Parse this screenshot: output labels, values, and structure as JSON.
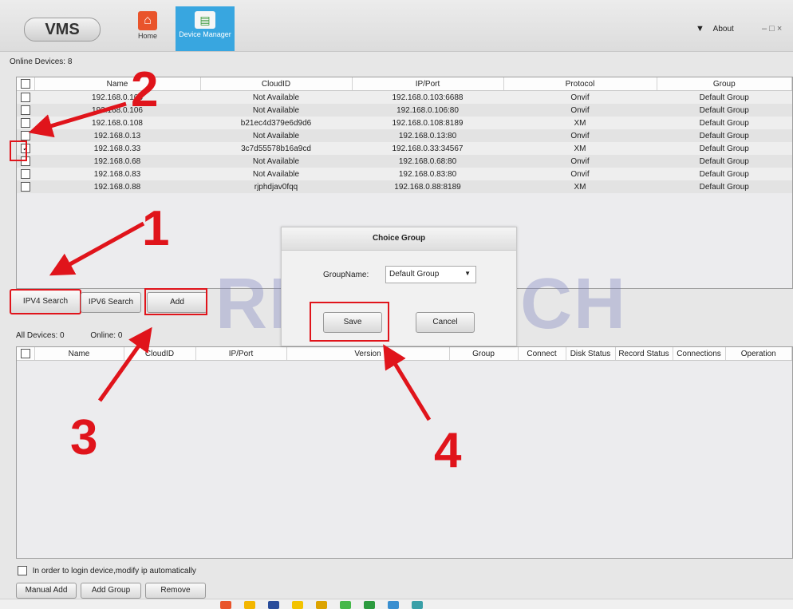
{
  "app": {
    "logo": "VMS",
    "about_label": "About",
    "window_controls": "– □ ×"
  },
  "nav": [
    {
      "label": "Home",
      "icon": "home-icon"
    },
    {
      "label": "Device Manager",
      "icon": "device-manager-icon",
      "active": true
    }
  ],
  "online": {
    "label": "Online Devices:",
    "count": "8"
  },
  "online_table": {
    "columns": [
      "Name",
      "CloudID",
      "IP/Port",
      "Protocol",
      "Group"
    ],
    "rows": [
      {
        "checked": false,
        "name": "192.168.0.103",
        "cloud": "Not Available",
        "ip": "192.168.0.103:6688",
        "protocol": "Onvif",
        "group": "Default Group"
      },
      {
        "checked": false,
        "name": "192.168.0.106",
        "cloud": "Not Available",
        "ip": "192.168.0.106:80",
        "protocol": "Onvif",
        "group": "Default Group"
      },
      {
        "checked": false,
        "name": "192.168.0.108",
        "cloud": "b21ec4d379e6d9d6",
        "ip": "192.168.0.108:8189",
        "protocol": "XM",
        "group": "Default Group"
      },
      {
        "checked": false,
        "name": "192.168.0.13",
        "cloud": "Not Available",
        "ip": "192.168.0.13:80",
        "protocol": "Onvif",
        "group": "Default Group"
      },
      {
        "checked": true,
        "name": "192.168.0.33",
        "cloud": "3c7d55578b16a9cd",
        "ip": "192.168.0.33:34567",
        "protocol": "XM",
        "group": "Default Group"
      },
      {
        "checked": false,
        "name": "192.168.0.68",
        "cloud": "Not Available",
        "ip": "192.168.0.68:80",
        "protocol": "Onvif",
        "group": "Default Group"
      },
      {
        "checked": false,
        "name": "192.168.0.83",
        "cloud": "Not Available",
        "ip": "192.168.0.83:80",
        "protocol": "Onvif",
        "group": "Default Group"
      },
      {
        "checked": false,
        "name": "192.168.0.88",
        "cloud": "rjphdjav0fqq",
        "ip": "192.168.0.88:8189",
        "protocol": "XM",
        "group": "Default Group"
      }
    ]
  },
  "search_buttons": {
    "ipv4": "IPV4 Search",
    "ipv6": "IPV6 Search",
    "add": "Add"
  },
  "all_devices": {
    "label": "All Devices:",
    "count": "0",
    "online_label": "Online:",
    "online_count": "0"
  },
  "all_table": {
    "columns": [
      "Name",
      "CloudID",
      "IP/Port",
      "Version",
      "Group",
      "Connect",
      "Disk Status",
      "Record Status",
      "Connections",
      "Operation"
    ]
  },
  "dialog": {
    "title": "Choice Group",
    "group_label": "GroupName:",
    "group_value": "Default Group",
    "save": "Save",
    "cancel": "Cancel"
  },
  "auto_ip_label": "In order to login device,modify ip automatically",
  "bottom_buttons": {
    "manual_add": "Manual Add",
    "add_group": "Add Group",
    "remove": "Remove"
  },
  "watermark": "REVOTECH",
  "annotations": [
    "1",
    "2",
    "3",
    "4"
  ],
  "colors": {
    "accent": "#38a6e0",
    "annotation": "#e0141b",
    "home": "#e9542b"
  }
}
